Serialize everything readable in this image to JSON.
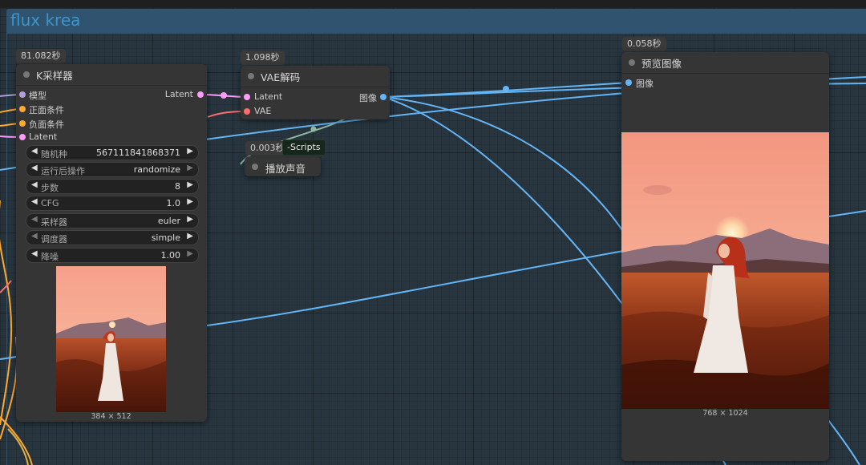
{
  "group": {
    "title": "flux krea"
  },
  "sampler": {
    "time": "81.082秒",
    "title": "K采样器",
    "inputs": [
      "模型",
      "正面条件",
      "负面条件",
      "Latent"
    ],
    "output": "Latent",
    "widgets": [
      {
        "label": "随机种",
        "value": "567111841868371"
      },
      {
        "label": "运行后操作",
        "value": "randomize"
      },
      {
        "label": "步数",
        "value": "8"
      },
      {
        "label": "CFG",
        "value": "1.0"
      },
      {
        "label": "采样器",
        "value": "euler"
      },
      {
        "label": "调度器",
        "value": "simple"
      },
      {
        "label": "降噪",
        "value": "1.00"
      }
    ],
    "preview_size": "384 × 512"
  },
  "vae": {
    "time": "1.098秒",
    "title": "VAE解码",
    "inputs": [
      "Latent",
      "VAE"
    ],
    "output": "图像"
  },
  "sound": {
    "time": "0.003秒",
    "title": "播放声音",
    "tooltip": "-Scripts"
  },
  "preview": {
    "time": "0.058秒",
    "title": "预览图像",
    "input": "图像",
    "image_size": "768 × 1024"
  },
  "colors": {
    "image_link": "#64b5f6",
    "latent_link": "#ff9cf9",
    "conditioning_link": "#ffa931",
    "vae_link": "#ff6e6e",
    "model_link": "#b39ddb",
    "group_header": "#30546f",
    "group_title": "#3d95c9"
  }
}
